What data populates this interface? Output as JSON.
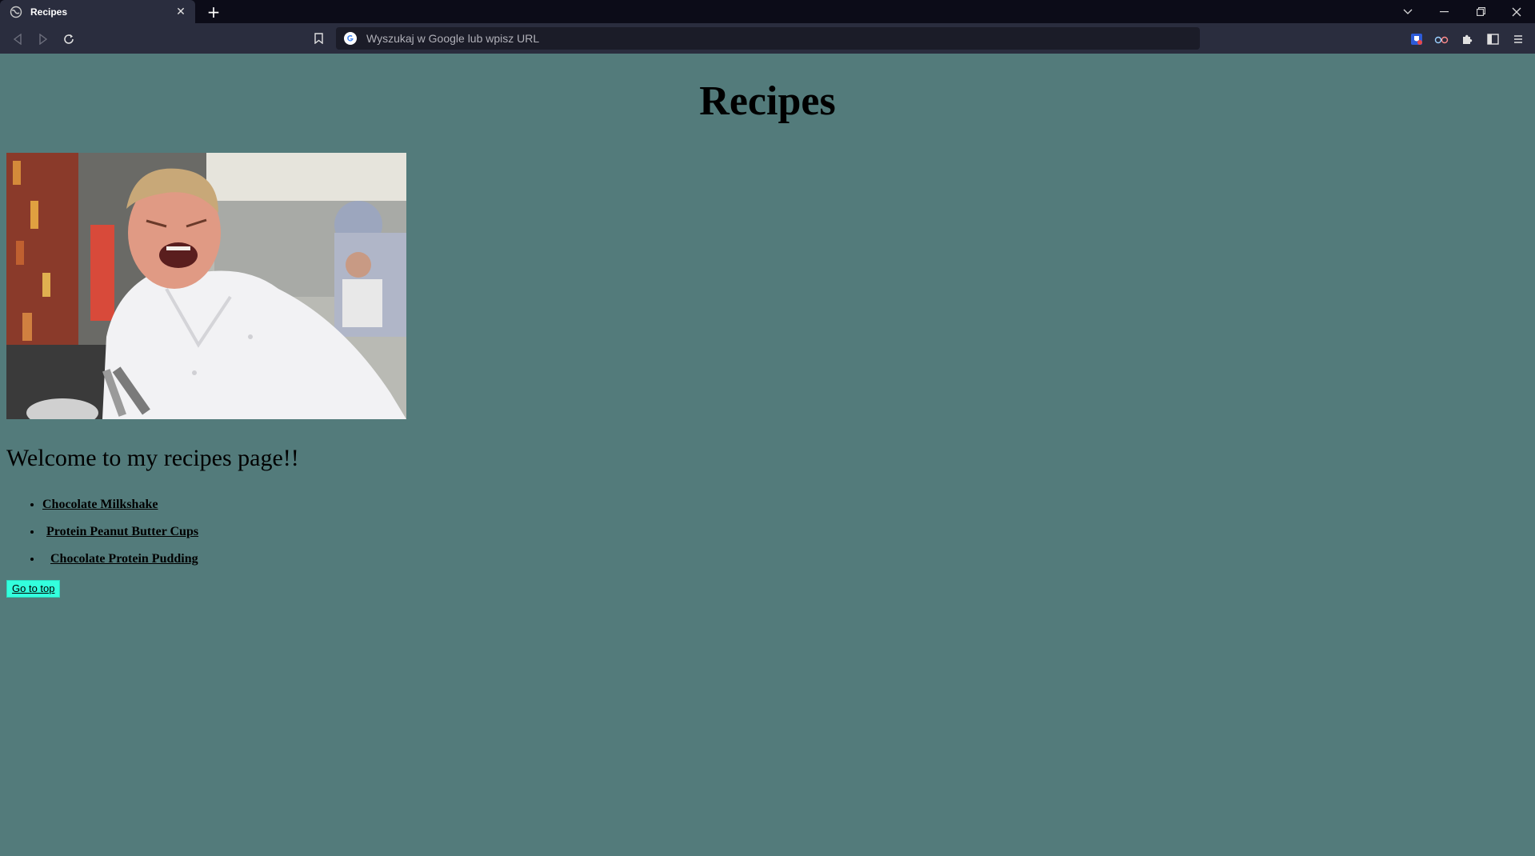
{
  "browser": {
    "tab_title": "Recipes",
    "omnibox_placeholder": "Wyszukaj w Google lub wpisz URL"
  },
  "page": {
    "title": "Recipes",
    "welcome": "Welcome to my recipes page!!",
    "recipes": [
      {
        "label": "Chocolate Milkshake"
      },
      {
        "label": "Protein Peanut Butter Cups"
      },
      {
        "label": "Chocolate Protein Pudding"
      }
    ],
    "go_to_top": "Go to top"
  },
  "colors": {
    "page_background": "#537b7b",
    "button_background": "#33ffdd",
    "chrome_background": "#2a2d3e"
  }
}
